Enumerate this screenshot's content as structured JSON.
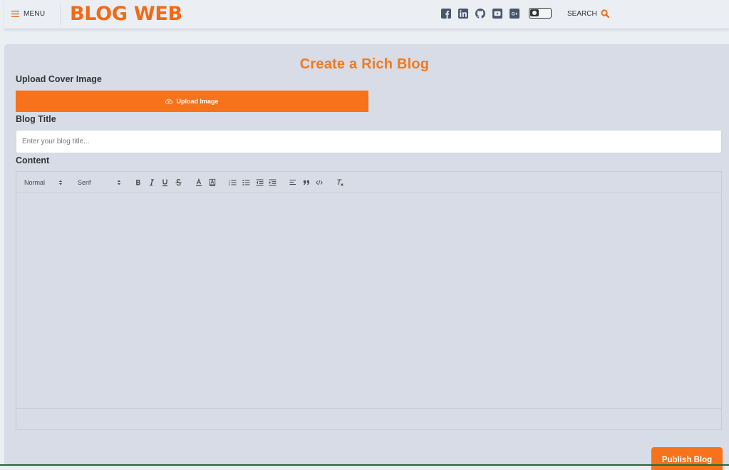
{
  "nav": {
    "menu_label": "MENU",
    "brand": "BLOG WEB",
    "social_icons": [
      "facebook-icon",
      "linkedin-icon",
      "github-icon",
      "youtube-icon",
      "google-plus-icon"
    ],
    "search_label": "SEARCH",
    "accent": "#f16a17"
  },
  "form": {
    "heading": "Create a Rich Blog",
    "cover_label": "Upload Cover Image",
    "upload_button": "Upload Image",
    "title_label": "Blog Title",
    "title_placeholder": "Enter your blog title...",
    "title_value": "",
    "content_label": "Content",
    "publish_button": "Publish Blog"
  },
  "editor": {
    "header_select": "Normal",
    "font_select": "Serif"
  },
  "colors": {
    "primary_orange": "#f6721b",
    "panel_bg": "#d7dce6",
    "nav_bg": "#ebeef3"
  }
}
